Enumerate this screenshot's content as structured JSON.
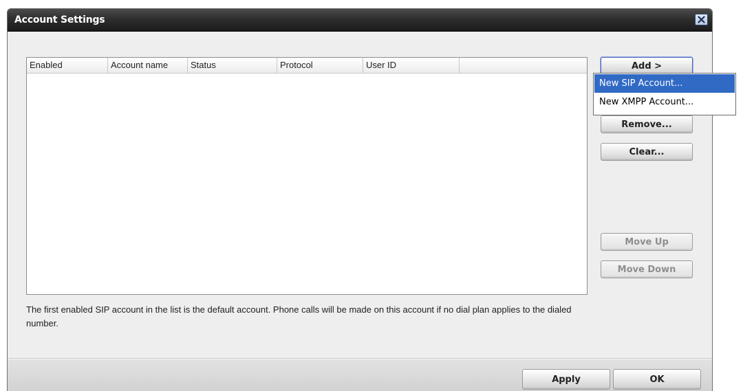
{
  "window": {
    "title": "Account Settings"
  },
  "table": {
    "columns": [
      "Enabled",
      "Account name",
      "Status",
      "Protocol",
      "User ID"
    ],
    "rows": []
  },
  "buttons": {
    "add": "Add >",
    "remove": "Remove...",
    "clear": "Clear...",
    "move_up": "Move Up",
    "move_down": "Move Down",
    "apply": "Apply",
    "ok": "OK"
  },
  "add_menu": {
    "items": [
      "New SIP Account...",
      "New XMPP Account..."
    ],
    "highlighted_index": 0
  },
  "help_text": "The first enabled SIP account in the list is the default account. Phone calls will be made on this account if no dial plan applies to the dialed number.",
  "colors": {
    "titlebar": "#2e2e2e",
    "highlight": "#316ac5",
    "dialog_bg": "#eeeeee"
  },
  "icons": {
    "close": "close-x-icon"
  }
}
